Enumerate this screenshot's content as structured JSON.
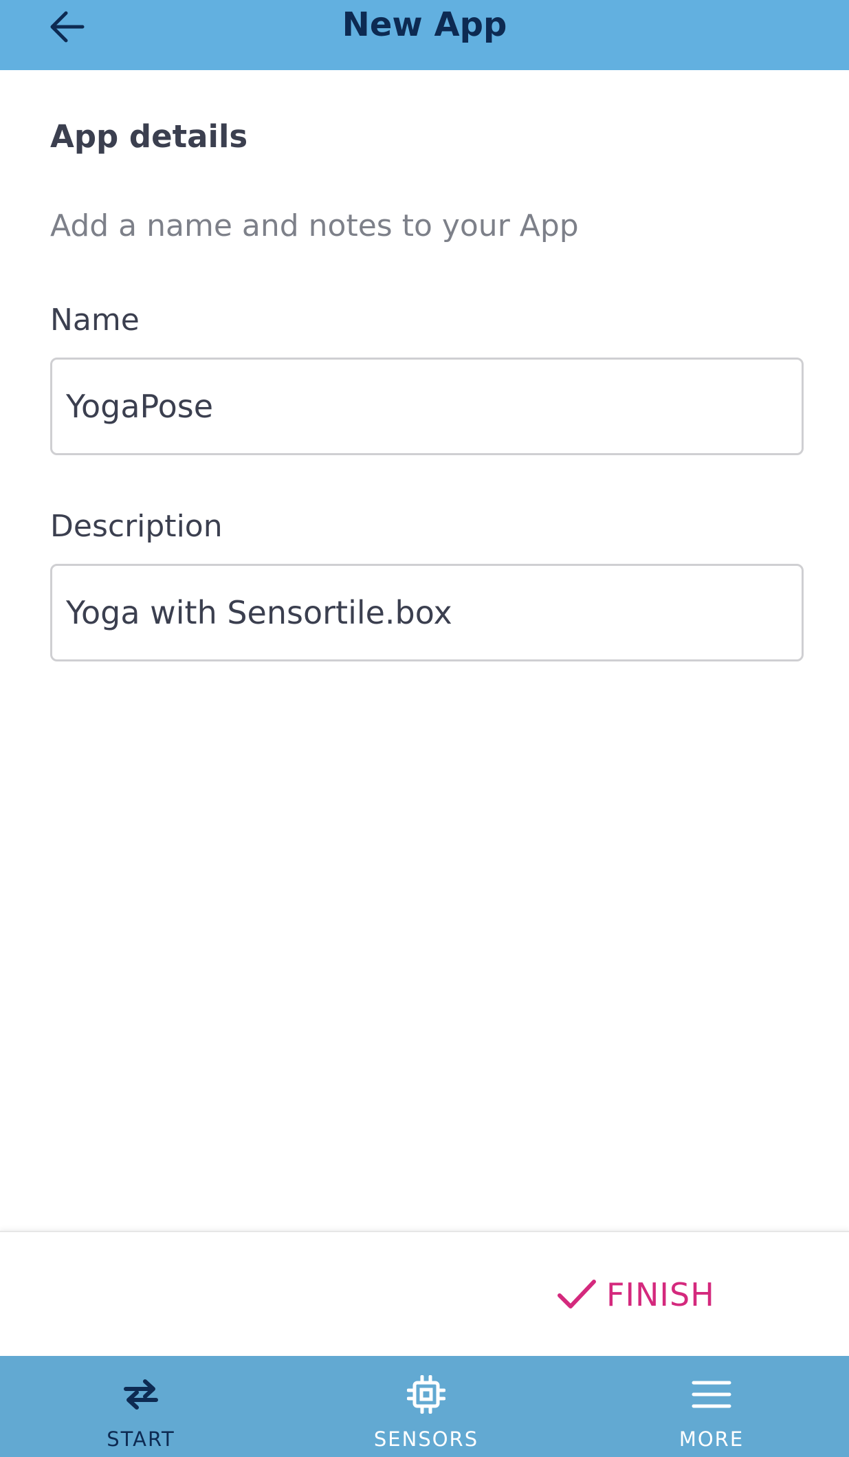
{
  "header": {
    "title": "New App"
  },
  "content": {
    "section_title": "App details",
    "subtitle": "Add a name and notes to your App",
    "name_field": {
      "label": "Name",
      "value": "YogaPose"
    },
    "description_field": {
      "label": "Description",
      "value": "Yoga with Sensortile.box"
    }
  },
  "action_bar": {
    "finish_label": "FINISH"
  },
  "bottom_nav": {
    "items": [
      {
        "label": "START",
        "icon": "swap-arrows-icon"
      },
      {
        "label": "SENSORS",
        "icon": "chip-icon"
      },
      {
        "label": "MORE",
        "icon": "menu-icon"
      }
    ]
  },
  "colors": {
    "header_bg": "#62b0e0",
    "nav_bg": "#62a9d2",
    "title_text": "#0d2a52",
    "accent": "#d4297d",
    "nav_start_text": "#0d2a52",
    "nav_inactive_text": "#ffffff"
  }
}
